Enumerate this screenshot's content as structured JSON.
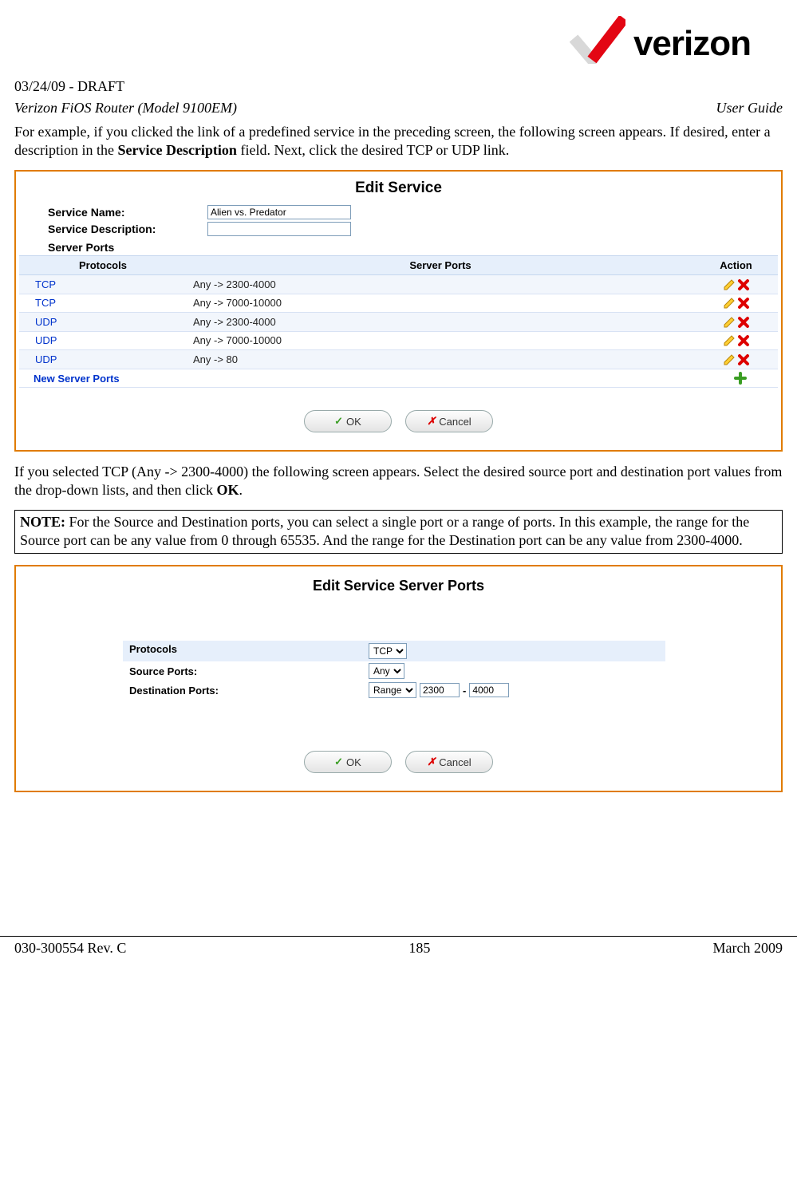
{
  "header": {
    "draft": "03/24/09 - DRAFT",
    "model": "Verizon FiOS Router (Model 9100EM)",
    "guide": "User Guide",
    "brand": "verizon"
  },
  "text": {
    "para1a": "For example, if you clicked the link of a predefined service in the preceding screen, the following screen appears. If desired, enter a description in the ",
    "para1b": "Service Description",
    "para1c": " field. Next, click the desired TCP or UDP link.",
    "para2a": "If you selected TCP (Any -> 2300-4000) the following screen appears. Select the desired source port and destination port values from the drop-down lists, and then click ",
    "para2b": "OK",
    "para2c": ".",
    "noteLabel": "NOTE:",
    "noteBody": " For the Source and Destination ports, you can select a single port or a range of ports. In this example, the range for the Source port can be any value from 0 through 65535. And the range for the Destination port can be any value from 2300-4000."
  },
  "panel1": {
    "title": "Edit Service",
    "serviceNameLabel": "Service Name:",
    "serviceNameValue": "Alien vs. Predator",
    "serviceDescLabel": "Service Description:",
    "serviceDescValue": "",
    "serverPortsLabel": "Server Ports",
    "headers": {
      "protocols": "Protocols",
      "serverPorts": "Server Ports",
      "action": "Action"
    },
    "rows": [
      {
        "proto": "TCP",
        "ports": "Any -> 2300-4000"
      },
      {
        "proto": "TCP",
        "ports": "Any -> 7000-10000"
      },
      {
        "proto": "UDP",
        "ports": "Any -> 2300-4000"
      },
      {
        "proto": "UDP",
        "ports": "Any -> 7000-10000"
      },
      {
        "proto": "UDP",
        "ports": "Any -> 80"
      }
    ],
    "newRow": "New Server Ports",
    "okLabel": "OK",
    "cancelLabel": "Cancel"
  },
  "panel2": {
    "title": "Edit Service Server Ports",
    "protocolsLabel": "Protocols",
    "protocolValue": "TCP",
    "sourceLabel": "Source Ports:",
    "sourceValue": "Any",
    "destLabel": "Destination Ports:",
    "destSelect": "Range",
    "destFrom": "2300",
    "destTo": "4000",
    "dash": "-",
    "okLabel": "OK",
    "cancelLabel": "Cancel"
  },
  "footer": {
    "left": "030-300554 Rev. C",
    "center": "185",
    "right": "March 2009"
  }
}
